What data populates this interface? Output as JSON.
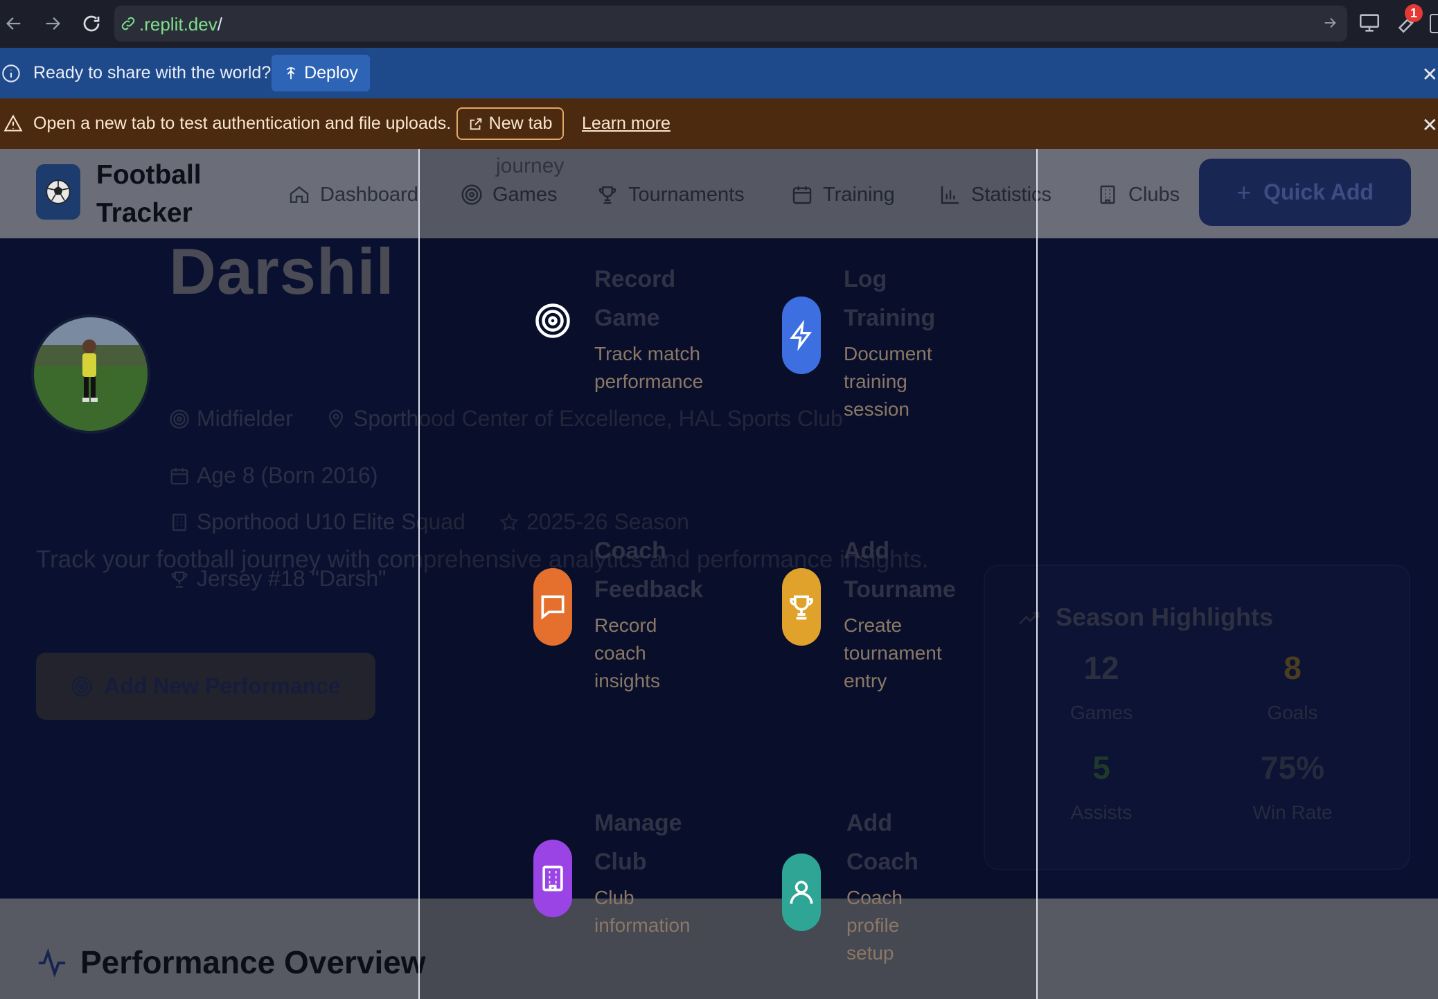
{
  "browser": {
    "url_domain": ".replit.dev",
    "url_path": "/",
    "notification_count": "1"
  },
  "deploy_banner": {
    "message": "Ready to share with the world?",
    "button_label": "Deploy"
  },
  "auth_banner": {
    "message": "Open a new tab to test authentication and file uploads.",
    "button_label": "New tab",
    "link_label": "Learn more"
  },
  "header": {
    "brand_line1": "Football",
    "brand_line2": "Tracker",
    "ghost_text": "journey",
    "nav": [
      {
        "label": "Dashboard",
        "icon": "home-icon"
      },
      {
        "label": "Games",
        "icon": "target-icon"
      },
      {
        "label": "Tournaments",
        "icon": "trophy-icon"
      },
      {
        "label": "Training",
        "icon": "calendar-icon"
      },
      {
        "label": "Statistics",
        "icon": "bar-chart-icon"
      },
      {
        "label": "Clubs",
        "icon": "building-icon"
      }
    ],
    "quick_add_label": "Quick Add"
  },
  "profile": {
    "name": "Darshil",
    "position": "Midfielder",
    "location": "Sporthood Center of Excellence, HAL Sports Club",
    "age": "Age 8 (Born 2016)",
    "squad": "Sporthood U10 Elite Squad",
    "season": "2025-26 Season",
    "jersey": "Jersey #18 \"Darsh\"",
    "tagline": "Track your football journey with comprehensive analytics and performance insights.",
    "add_performance_label": "Add New Performance"
  },
  "season_highlights": {
    "title": "Season Highlights",
    "stats": [
      {
        "value": "12",
        "label": "Games",
        "color": "#2b2f3f"
      },
      {
        "value": "8",
        "label": "Goals",
        "color": "#4a3e1e"
      },
      {
        "value": "5",
        "label": "Assists",
        "color": "#1f3a2a"
      },
      {
        "value": "75%",
        "label": "Win Rate",
        "color": "#262b3c"
      }
    ]
  },
  "performance": {
    "title": "Performance Overview"
  },
  "quick_add_menu": {
    "options": [
      {
        "title_line1": "Record",
        "title_line2": "Game",
        "desc": [
          "Track match",
          "performance"
        ],
        "icon": "target-icon",
        "color": "#ffffff"
      },
      {
        "title_line1": "Log",
        "title_line2": "Training",
        "desc": [
          "Document",
          "training",
          "session"
        ],
        "icon": "lightning-icon",
        "color": "#3d6fe0"
      },
      {
        "title_line1": "Coach",
        "title_line2": "Feedback",
        "desc": [
          "Record",
          "coach",
          "insights"
        ],
        "icon": "message-icon",
        "color": "#e5702d"
      },
      {
        "title_line1": "Add",
        "title_line2": "Tourname",
        "desc": [
          "Create",
          "tournament",
          "entry"
        ],
        "icon": "trophy-icon",
        "color": "#e0a22a"
      },
      {
        "title_line1": "Manage",
        "title_line2": "Club",
        "desc": [
          "Club",
          "information"
        ],
        "icon": "building-icon",
        "color": "#9b44e6"
      },
      {
        "title_line1": "Add",
        "title_line2": "Coach",
        "desc": [
          "Coach",
          "profile",
          "setup"
        ],
        "icon": "user-icon",
        "color": "#2fa596"
      }
    ]
  }
}
